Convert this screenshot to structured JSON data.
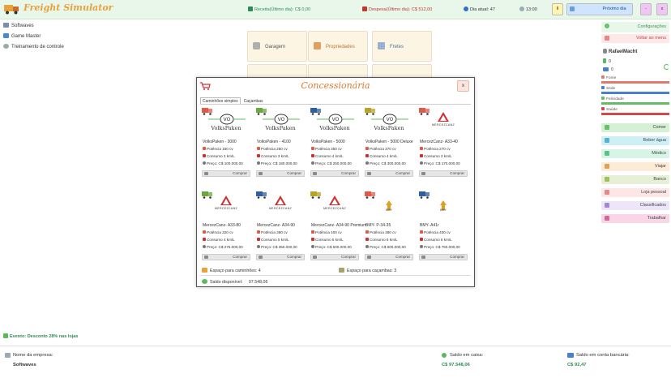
{
  "app": {
    "title": "Freight Simulator"
  },
  "topbar": {
    "receita_label": "Receita(Último dia): C$",
    "receita_value": "0,00",
    "despesa_label": "Despesa(Último dia): C$",
    "despesa_value": "512,00",
    "dia_label": "Dia atual:",
    "dia_value": "47",
    "time": "13:00",
    "pause_label": "II",
    "next_day_label": "Próximo dia",
    "minimize_label": "-",
    "close_label": "x"
  },
  "leftmenu": {
    "items": [
      {
        "label": "Softwaves",
        "icon": "company-icon"
      },
      {
        "label": "Game Master",
        "icon": "computer-icon"
      },
      {
        "label": "Treinamento de controle",
        "icon": "gear-icon"
      }
    ]
  },
  "tiles": [
    {
      "label": "Garagem",
      "icon": "wrench-icon"
    },
    {
      "label": "Propriedades",
      "icon": "house-icon"
    },
    {
      "label": "Fretes",
      "icon": "document-icon"
    }
  ],
  "modal": {
    "title": "Concessionária",
    "close_label": "x",
    "tabs": [
      "Caminhões simples",
      "Caçambas"
    ],
    "buy_label": "Comprar",
    "trucks": [
      {
        "name": "VolksPaken - 3000",
        "brand": "VolksPaken",
        "potencia": "Potência 150 cv",
        "consumo": "Consumo 3 km/L",
        "preco": "Preço: C$ 100.000,00",
        "truck_color": "#e05a4a"
      },
      {
        "name": "VolksPaken - 4100",
        "brand": "VolksPaken",
        "potencia": "Potência 250 cv",
        "consumo": "Consumo 3 km/L",
        "preco": "Preço: C$ 180.000,00",
        "truck_color": "#6aa83c"
      },
      {
        "name": "VolksPaken - 5000",
        "brand": "VolksPaken",
        "potencia": "Potência 350 cv",
        "consumo": "Consumo 4 km/L",
        "preco": "Preço: C$ 250.000,00",
        "truck_color": "#2f5f9e"
      },
      {
        "name": "VolksPaken - 5000 Deluxe",
        "brand": "VolksPaken",
        "potencia": "Potência 370 cv",
        "consumo": "Consumo 4 km/L",
        "preco": "Preço: C$ 300.000,00",
        "truck_color": "#b9a326"
      },
      {
        "name": "MercezCanz- A33-40",
        "brand": "MERCEZCANZ",
        "potencia": "Potência 270 cv",
        "consumo": "Consumo 3 km/L",
        "preco": "Preço: C$ 170.000,00",
        "truck_color": "#e05a4a"
      },
      {
        "name": "MercezCanz- A33-80",
        "brand": "MERCEZCANZ",
        "potencia": "Potência 320 cv",
        "consumo": "Consumo 4 km/L",
        "preco": "Preço: C$ 275.000,00",
        "truck_color": "#6aa83c"
      },
      {
        "name": "MercezCanz- A34-90",
        "brand": "MERCEZCANZ",
        "potencia": "Potência 380 cv",
        "consumo": "Consumo 5 km/L",
        "preco": "Preço: C$ 350.000,00",
        "truck_color": "#2f5f9e"
      },
      {
        "name": "MercezCanz- A34-90 Premium",
        "brand": "MERCEZCANZ",
        "potencia": "Potência 400 cv",
        "consumo": "Consumo 5 km/L",
        "preco": "Preço: C$ 500.000,00",
        "truck_color": "#b9a326"
      },
      {
        "name": "BMY- P-34-35",
        "brand": "BMY",
        "potencia": "Potência 380 cv",
        "consumo": "Consumo 6 km/L",
        "preco": "Preço: C$ 600.000,00",
        "truck_color": "#e05a4a"
      },
      {
        "name": "BMY- A41r",
        "brand": "BMY",
        "potencia": "Potência 400 cv",
        "consumo": "Consumo 6 km/L",
        "preco": "Preço: C$ 750.000,00",
        "truck_color": "#2f5f9e"
      }
    ],
    "space_trucks": "Espaço para caminhões: 4",
    "space_trailers": "Espaço para caçambas: 3",
    "balance_label": "Saldo disponível:",
    "balance_value": "97.548,06"
  },
  "rightpanel": {
    "config_label": "Configurações",
    "voltar_label": "Voltar ao menu",
    "username": "RafaelMacht",
    "count_a": "0",
    "count_b": "0",
    "bars": [
      {
        "label": "Fome",
        "value": 1.0,
        "color": "#e07a6a"
      },
      {
        "label": "Sede",
        "value": 1.0,
        "color": "#4a7fd0"
      },
      {
        "label": "Felicidade",
        "value": 1.0,
        "color": "#66bb66"
      },
      {
        "label": "Saúde",
        "value": 1.0,
        "color": "#d04a4a"
      }
    ],
    "buttons": [
      {
        "label": "Comer",
        "color": "#d6f0d6",
        "icon_color": "#6cbf6c",
        "icon": "food-icon"
      },
      {
        "label": "Beber água",
        "color": "#cfeff6",
        "icon_color": "#5ab0d0",
        "icon": "water-icon"
      },
      {
        "label": "Médico",
        "color": "#d6f5e6",
        "icon_color": "#5cc08c",
        "icon": "medic-icon"
      },
      {
        "label": "Viajar",
        "color": "#fdebd6",
        "icon_color": "#e0a060",
        "icon": "suitcase-icon"
      },
      {
        "label": "Banco",
        "color": "#e6f0d6",
        "icon_color": "#a0c060",
        "icon": "bank-icon"
      },
      {
        "label": "Loja pessoal",
        "color": "#fde6e6",
        "icon_color": "#e08a8a",
        "icon": "shop-icon"
      },
      {
        "label": "Classificados",
        "color": "#ece6f8",
        "icon_color": "#a08ad0",
        "icon": "classified-icon"
      },
      {
        "label": "Trabalhar",
        "color": "#f8d6e6",
        "icon_color": "#d06a9a",
        "icon": "work-icon"
      }
    ]
  },
  "event": {
    "text": "Evento: Desconto 28% nas lojas"
  },
  "bottombar": {
    "company_label": "Nome da empresa:",
    "company_value": "Softwaves",
    "cash_label": "Saldo em caixa:",
    "cash_value": "C$ 97.548,06",
    "bank_label": "Saldo em conta bancária:",
    "bank_value": "C$ 92,47"
  }
}
